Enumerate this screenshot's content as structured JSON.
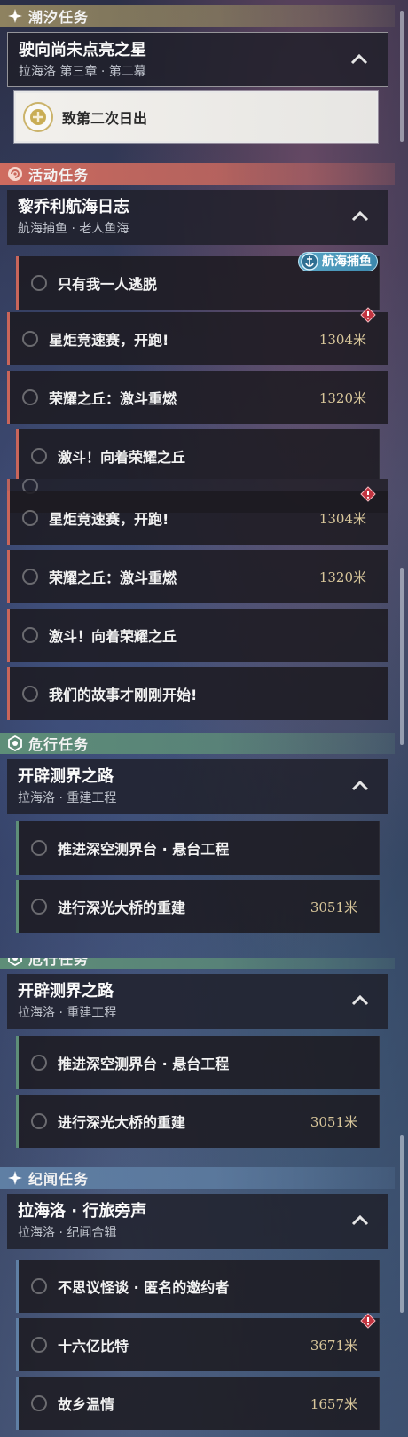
{
  "panel1": {
    "tide_section": {
      "label": "潮汐任务",
      "icon": "sparkle-icon",
      "color": "#8e8260"
    },
    "tide_quest": {
      "title": "驶向尚未点亮之星",
      "subtitle": "拉海洛 第三章 · 第二幕"
    },
    "tide_task": {
      "name": "致第二次日出",
      "state": "tracked"
    },
    "event_section": {
      "label": "活动任务",
      "icon": "event-icon",
      "color": "#cf6b5f"
    },
    "event_quest": {
      "title": "黎乔利航海日志",
      "subtitle": "航海捕鱼 · 老人鱼海"
    },
    "fishing_tag": "航海捕鱼",
    "tasks": [
      {
        "name": "只有我一人逃脱",
        "distance": ""
      },
      {
        "name": "星炬竞速赛，开跑!",
        "distance": "1304米",
        "alert": true
      },
      {
        "name": "荣耀之丘：激斗重燃",
        "distance": "1320米"
      },
      {
        "name": "激斗！向着荣耀之丘",
        "distance": ""
      }
    ]
  },
  "panel2": {
    "tasks": [
      {
        "name": "星炬竞速赛，开跑!",
        "distance": "1304米",
        "alert": true
      },
      {
        "name": "荣耀之丘：激斗重燃",
        "distance": "1320米"
      },
      {
        "name": "激斗！向着荣耀之丘",
        "distance": ""
      },
      {
        "name": "我们的故事才刚刚开始!",
        "distance": ""
      }
    ],
    "danger_section": {
      "label": "危行任务",
      "icon": "danger-icon",
      "color": "#5e8e78"
    },
    "danger_quest": {
      "title": "开辟测界之路",
      "subtitle": "拉海洛 · 重建工程"
    },
    "danger_tasks": [
      {
        "name": "推进深空测界台 · 悬台工程",
        "distance": ""
      },
      {
        "name": "进行深光大桥的重建",
        "distance": "3051米"
      }
    ]
  },
  "panel3": {
    "danger_section": {
      "label": "危行任务"
    },
    "danger_quest": {
      "title": "开辟测界之路",
      "subtitle": "拉海洛 · 重建工程"
    },
    "danger_tasks": [
      {
        "name": "推进深空测界台 · 悬台工程",
        "distance": ""
      },
      {
        "name": "进行深光大桥的重建",
        "distance": "3051米"
      }
    ],
    "record_section": {
      "label": "纪闻任务",
      "icon": "sparkle-icon",
      "color": "#5f7fa4"
    },
    "record_quest": {
      "title": "拉海洛 · 行旅旁声",
      "subtitle": "拉海洛 · 纪闻合辑"
    },
    "record_tasks": [
      {
        "name": "不思议怪谈 · 匿名的邀约者",
        "distance": ""
      },
      {
        "name": "十六亿比特",
        "distance": "3671米",
        "alert": true
      },
      {
        "name": "故乡温情",
        "distance": "1657米"
      }
    ]
  }
}
